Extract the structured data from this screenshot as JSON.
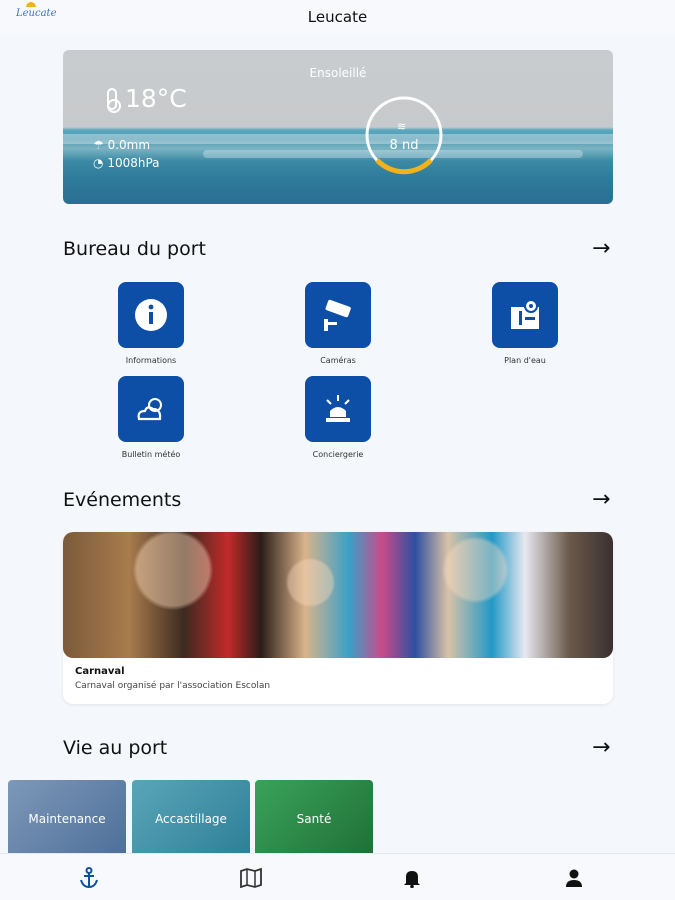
{
  "header": {
    "logo_text": "Leucate",
    "title": "Leucate"
  },
  "weather": {
    "condition": "Ensoleillé",
    "temperature": "18°C",
    "rain": "0.0mm",
    "pressure": "1008hPa",
    "wind": "8 nd"
  },
  "sections": {
    "bureau": "Bureau du port",
    "evenements": "Evénements",
    "vie": "Vie au port"
  },
  "tiles": [
    {
      "label": "Informations",
      "icon": "info-icon"
    },
    {
      "label": "Caméras",
      "icon": "camera-icon"
    },
    {
      "label": "Plan d'eau",
      "icon": "map-pin-icon"
    },
    {
      "label": "Bulletin météo",
      "icon": "cloud-sun-icon"
    },
    {
      "label": "Conciergerie",
      "icon": "siren-icon"
    }
  ],
  "event": {
    "title": "Carnaval",
    "subtitle": "Carnaval organisé par l'association Escolan"
  },
  "vie_cards": [
    {
      "label": "Maintenance",
      "color": "#5a7da6"
    },
    {
      "label": "Accastillage",
      "color": "#3f8fa8"
    },
    {
      "label": "Santé",
      "color": "#2e8a45"
    }
  ],
  "nav": [
    {
      "icon": "anchor-icon",
      "active": true
    },
    {
      "icon": "map-icon",
      "active": false
    },
    {
      "icon": "bell-icon",
      "active": false
    },
    {
      "icon": "user-icon",
      "active": false
    }
  ],
  "colors": {
    "accent": "#0d4ea6",
    "wind_gauge": "#f2b21b"
  }
}
